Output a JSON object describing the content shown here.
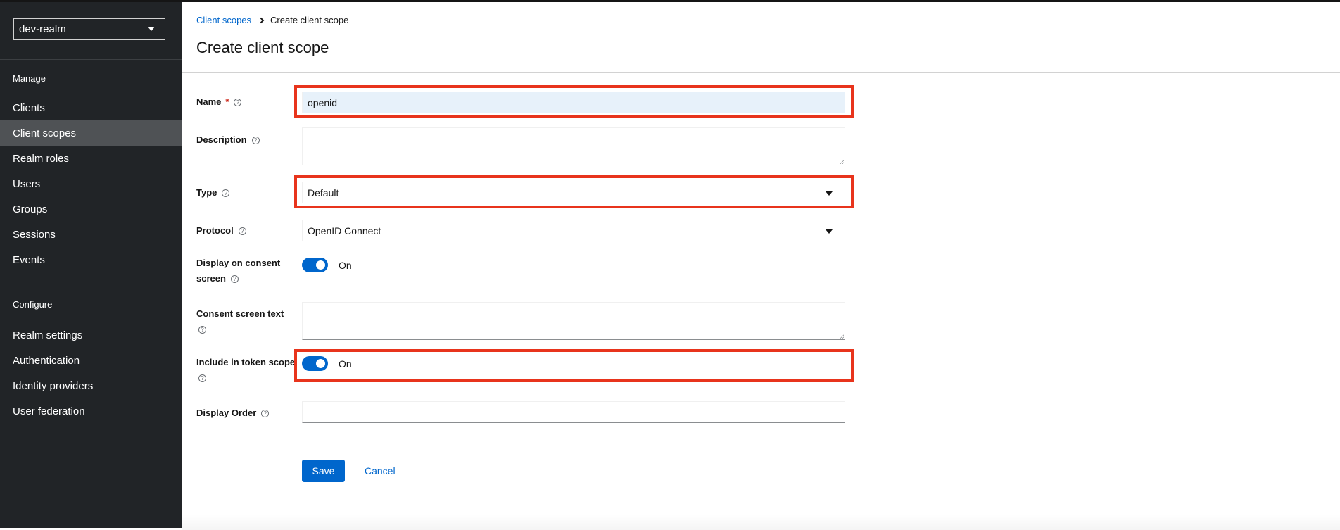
{
  "sidebar": {
    "realm": "dev-realm",
    "manage_label": "Manage",
    "configure_label": "Configure",
    "manage_items": [
      {
        "label": "Clients"
      },
      {
        "label": "Client scopes"
      },
      {
        "label": "Realm roles"
      },
      {
        "label": "Users"
      },
      {
        "label": "Groups"
      },
      {
        "label": "Sessions"
      },
      {
        "label": "Events"
      }
    ],
    "configure_items": [
      {
        "label": "Realm settings"
      },
      {
        "label": "Authentication"
      },
      {
        "label": "Identity providers"
      },
      {
        "label": "User federation"
      }
    ],
    "active_item": "Client scopes"
  },
  "breadcrumb": {
    "parent": "Client scopes",
    "current": "Create client scope"
  },
  "page": {
    "title": "Create client scope"
  },
  "form": {
    "name": {
      "label": "Name",
      "required_mark": "*",
      "value": "openid"
    },
    "description": {
      "label": "Description",
      "value": ""
    },
    "type": {
      "label": "Type",
      "value": "Default"
    },
    "protocol": {
      "label": "Protocol",
      "value": "OpenID Connect"
    },
    "display_on_consent": {
      "label_line1": "Display on consent",
      "label_line2": "screen",
      "state": "On",
      "on": true
    },
    "consent_text": {
      "label": "Consent screen text",
      "value": ""
    },
    "include_in_token": {
      "label": "Include in token scope",
      "state": "On",
      "on": true
    },
    "display_order": {
      "label": "Display Order",
      "value": ""
    },
    "help_glyph": "?"
  },
  "actions": {
    "save": "Save",
    "cancel": "Cancel"
  },
  "colors": {
    "primary": "#0066cc",
    "sidebar_bg": "#212427",
    "highlight": "#e8341c"
  }
}
